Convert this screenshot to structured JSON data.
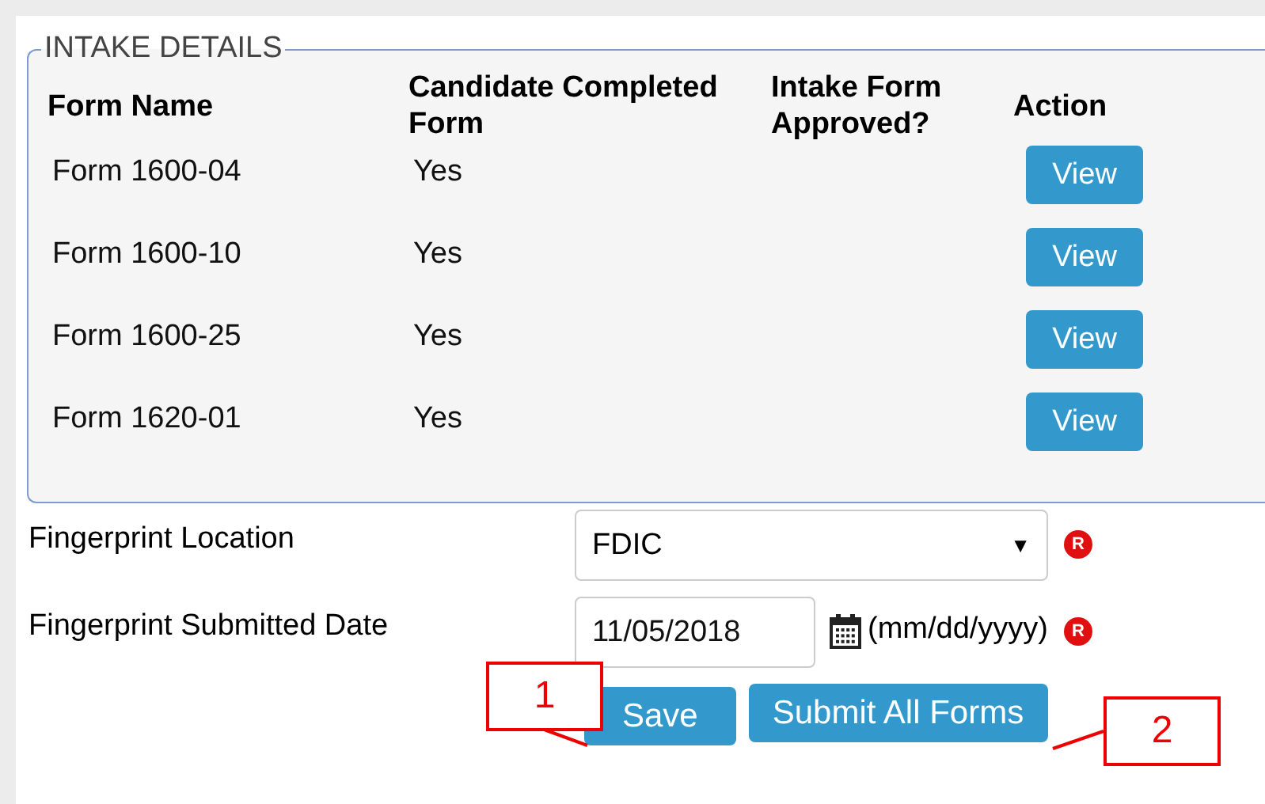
{
  "intake_details": {
    "legend": "INTAKE DETAILS",
    "columns": [
      "Form Name",
      "Candidate Completed Form",
      "Intake Form Approved?",
      "Action"
    ],
    "rows": [
      {
        "form_name": "Form 1600-04",
        "candidate_completed": "Yes",
        "action": "View"
      },
      {
        "form_name": "Form 1600-10",
        "candidate_completed": "Yes",
        "action": "View"
      },
      {
        "form_name": "Form 1600-25",
        "candidate_completed": "Yes",
        "action": "View"
      },
      {
        "form_name": "Form 1620-01",
        "candidate_completed": "Yes",
        "action": "View"
      }
    ]
  },
  "fields": [
    {
      "kind": "select",
      "label": "Fingerprint Location",
      "value": "FDIC",
      "caret": "▼",
      "required_mark": "R"
    },
    {
      "kind": "date",
      "label": "Fingerprint Submitted Date",
      "value": "11/05/2018",
      "hint": "(mm/dd/yyyy)",
      "required_mark": "R"
    }
  ],
  "buttons": [
    "Save",
    "Submit All Forms"
  ],
  "callouts": [
    "1",
    "2"
  ]
}
